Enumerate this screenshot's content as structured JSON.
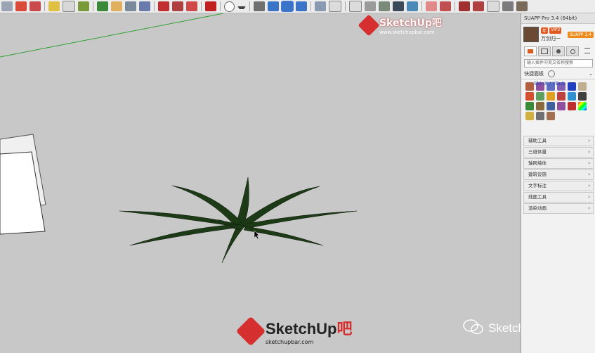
{
  "panel": {
    "title": "SUAPP Pro 3.4 (64bit)",
    "user_name": "万剑归一",
    "badge_year": "年",
    "badge_vip": "VIP2",
    "pro_badge": "SUAPP 3.4",
    "search_placeholder": "输入插件中英文名称搜索",
    "quick_panel_label": "快捷面板",
    "icon_label": "SkinX / YBub",
    "categories": [
      "辅助工具",
      "三维体量",
      "轴网墙体",
      "建筑设施",
      "文字标注",
      "线面工具",
      "渲染动画"
    ]
  },
  "watermark_top": {
    "brand": "SketchUp吧",
    "url": "www.sketchupbar.com"
  },
  "watermark_bottom": {
    "brand": "SketchUp",
    "ba": "吧",
    "url": "sketchupbar.com"
  },
  "wechat_label": "SketchUp吧",
  "colors": {
    "plant": "#1d3a17",
    "brand_red": "#d62f2f",
    "panel_bg": "#f2f2f2",
    "viewport_bg": "#c8c8c8",
    "axis_green": "#2fa02f"
  }
}
